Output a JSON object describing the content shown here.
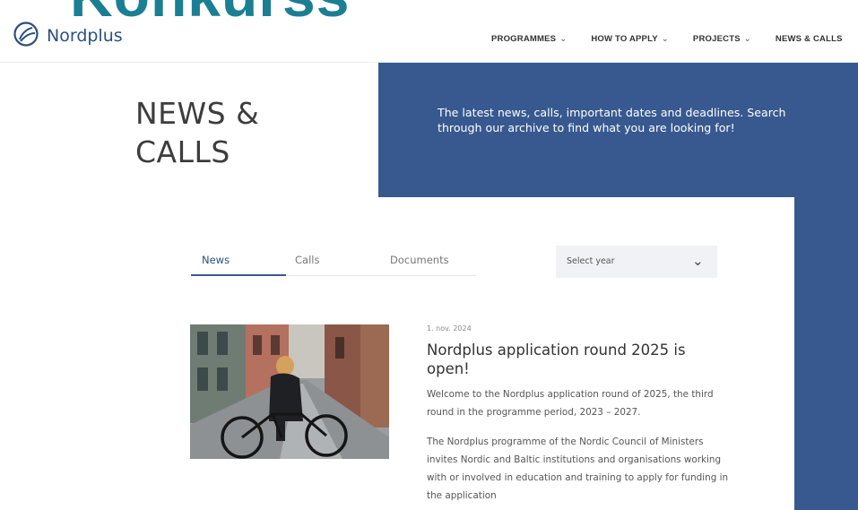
{
  "overlay": {
    "title": "Konkurss"
  },
  "header": {
    "logo_text": "Nordplus",
    "nav": [
      {
        "label": "PROGRAMMES"
      },
      {
        "label": "HOW TO APPLY"
      },
      {
        "label": "PROJECTS"
      },
      {
        "label": "NEWS & CALLS"
      }
    ]
  },
  "hero": {
    "title_line1": "NEWS &",
    "title_line2": "CALLS",
    "intro": "The latest news, calls, important dates and deadlines. Search through our archive to find what you are looking for!"
  },
  "tabs": [
    {
      "label": "News",
      "active": true
    },
    {
      "label": "Calls",
      "active": false
    },
    {
      "label": "Documents",
      "active": false
    }
  ],
  "filter": {
    "year_placeholder": "Select year"
  },
  "article": {
    "date": "1. nov. 2024",
    "title": "Nordplus application round 2025 is open!",
    "paragraph1": "Welcome to the Nordplus application round of 2025, the third round in the programme period, 2023 – 2027.",
    "paragraph2": "The Nordplus programme of the Nordic Council of Ministers invites Nordic and Baltic institutions and organisations working with or involved in education and training to apply for funding in the application"
  },
  "colors": {
    "brand_blue": "#38598f",
    "overlay_teal": "#1b7f94",
    "logo_blue": "#2b4f7e"
  },
  "icons": {
    "logo": "nordplus-logo-icon",
    "chevron": "chevron-down-icon"
  }
}
